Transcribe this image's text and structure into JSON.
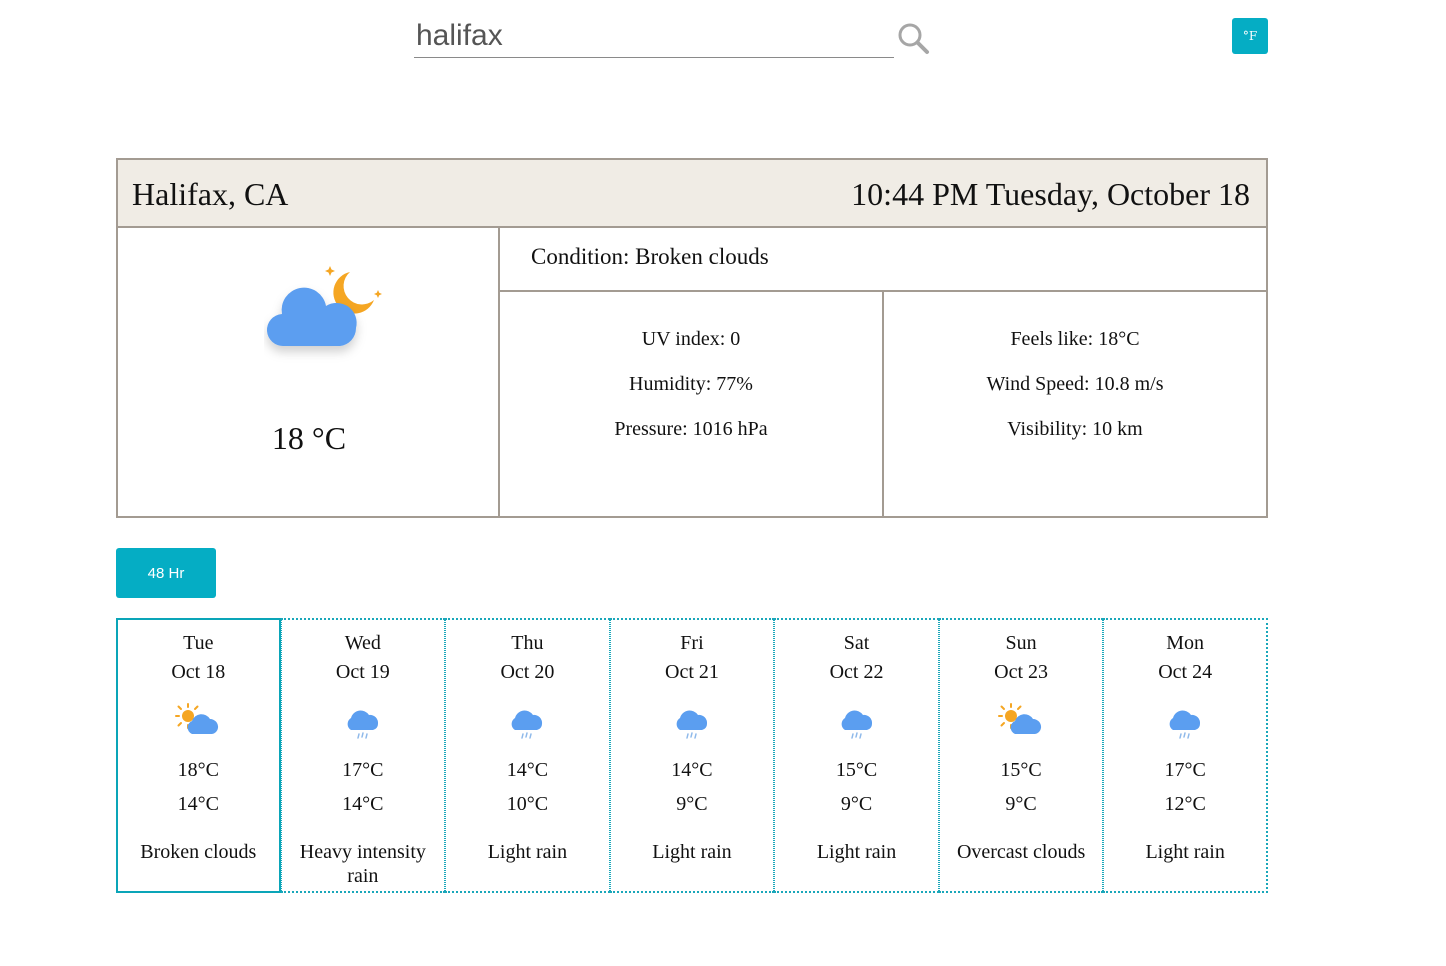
{
  "search": {
    "value": "halifax"
  },
  "unit_toggle_label": "°F",
  "current": {
    "location": "Halifax, CA",
    "datetime": "10:44 PM Tuesday, October 18",
    "temperature": "18 °C",
    "icon": "cloud-moon-icon",
    "condition": "Condition: Broken clouds",
    "stats_left": [
      "UV index: 0",
      "Humidity: 77%",
      "Pressure: 1016 hPa"
    ],
    "stats_right": [
      "Feels like: 18°C",
      "Wind Speed: 10.8 m/s",
      "Visibility: 10 km"
    ]
  },
  "hourly_button_label": "48 Hr",
  "forecast": [
    {
      "day": "Tue",
      "date": "Oct 18",
      "icon": "sun-cloud-icon",
      "high": "18°C",
      "low": "14°C",
      "desc": "Broken clouds"
    },
    {
      "day": "Wed",
      "date": "Oct 19",
      "icon": "rain-cloud-icon",
      "high": "17°C",
      "low": "14°C",
      "desc": "Heavy intensity rain"
    },
    {
      "day": "Thu",
      "date": "Oct 20",
      "icon": "rain-cloud-icon",
      "high": "14°C",
      "low": "10°C",
      "desc": "Light rain"
    },
    {
      "day": "Fri",
      "date": "Oct 21",
      "icon": "rain-cloud-icon",
      "high": "14°C",
      "low": "9°C",
      "desc": "Light rain"
    },
    {
      "day": "Sat",
      "date": "Oct 22",
      "icon": "rain-cloud-icon",
      "high": "15°C",
      "low": "9°C",
      "desc": "Light rain"
    },
    {
      "day": "Sun",
      "date": "Oct 23",
      "icon": "sun-cloud-icon",
      "high": "15°C",
      "low": "9°C",
      "desc": "Overcast clouds"
    },
    {
      "day": "Mon",
      "date": "Oct 24",
      "icon": "rain-cloud-icon",
      "high": "17°C",
      "low": "12°C",
      "desc": "Light rain"
    }
  ],
  "colors": {
    "accent": "#05adc4",
    "header_bg": "#f0ece5",
    "border": "#a39b92",
    "cloud": "#5b9ef0",
    "sun": "#f5a623"
  }
}
